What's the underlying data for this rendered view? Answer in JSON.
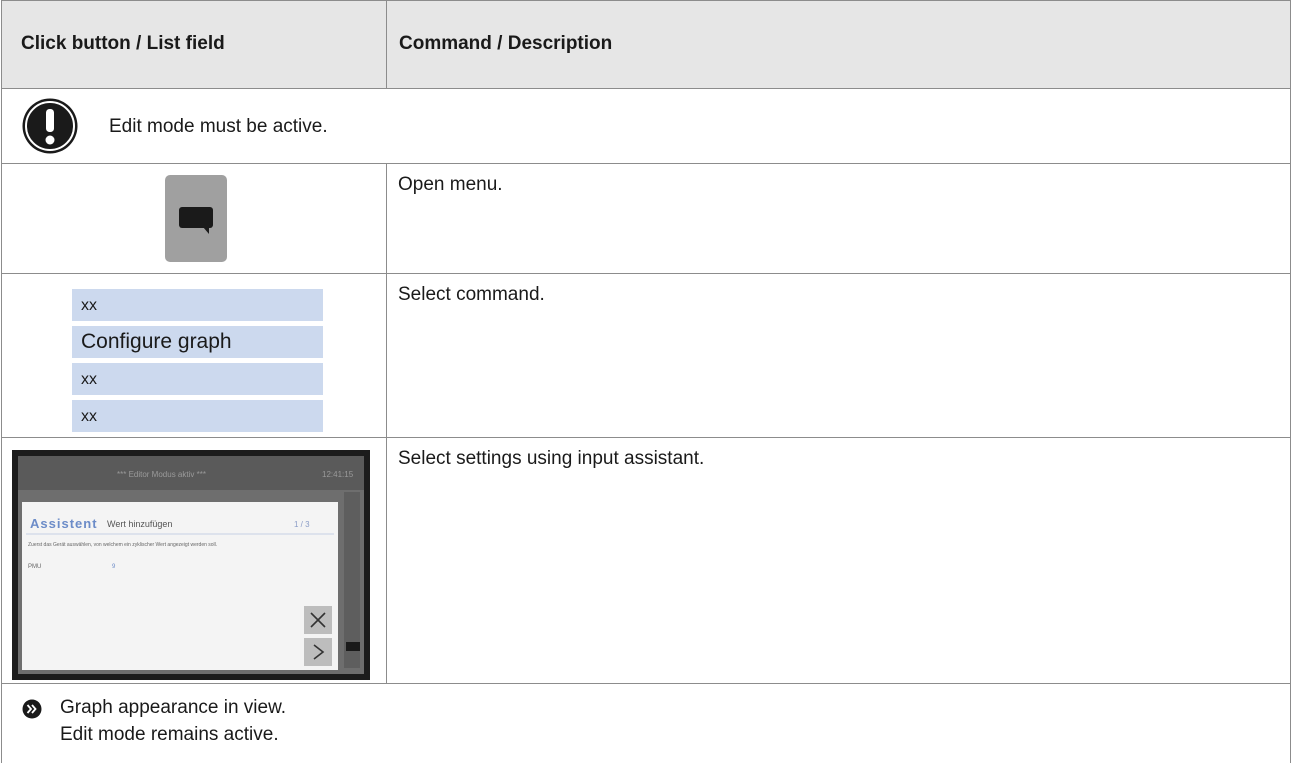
{
  "header": {
    "col1": "Click button / List field",
    "col2": "Command / Description"
  },
  "note": {
    "icon": "exclamation-icon",
    "text": "Edit mode must be active."
  },
  "rows": [
    {
      "description": "Open menu.",
      "icon": "menu-speech-bubble-icon"
    },
    {
      "description": "Select command.",
      "list_items": [
        "xx",
        "Configure graph",
        "xx",
        "xx"
      ]
    },
    {
      "description": "Select settings using input assistant.",
      "screenshot": {
        "title": "*** Editor Modus aktiv ***",
        "time": "12:41:15",
        "assistant_label": "Assistent",
        "assistant_title": "Wert hinzufügen",
        "step": "1 / 3",
        "instruction": "Zuerst das Gerät auswählen, von welchem ein zyklischer Wert angezeigt werden soll.",
        "field_label": "PMU",
        "field_value": "9"
      }
    }
  ],
  "result": {
    "icon": "result-arrow-icon",
    "line1": "Graph appearance in view.",
    "line2": "Edit mode remains active."
  }
}
